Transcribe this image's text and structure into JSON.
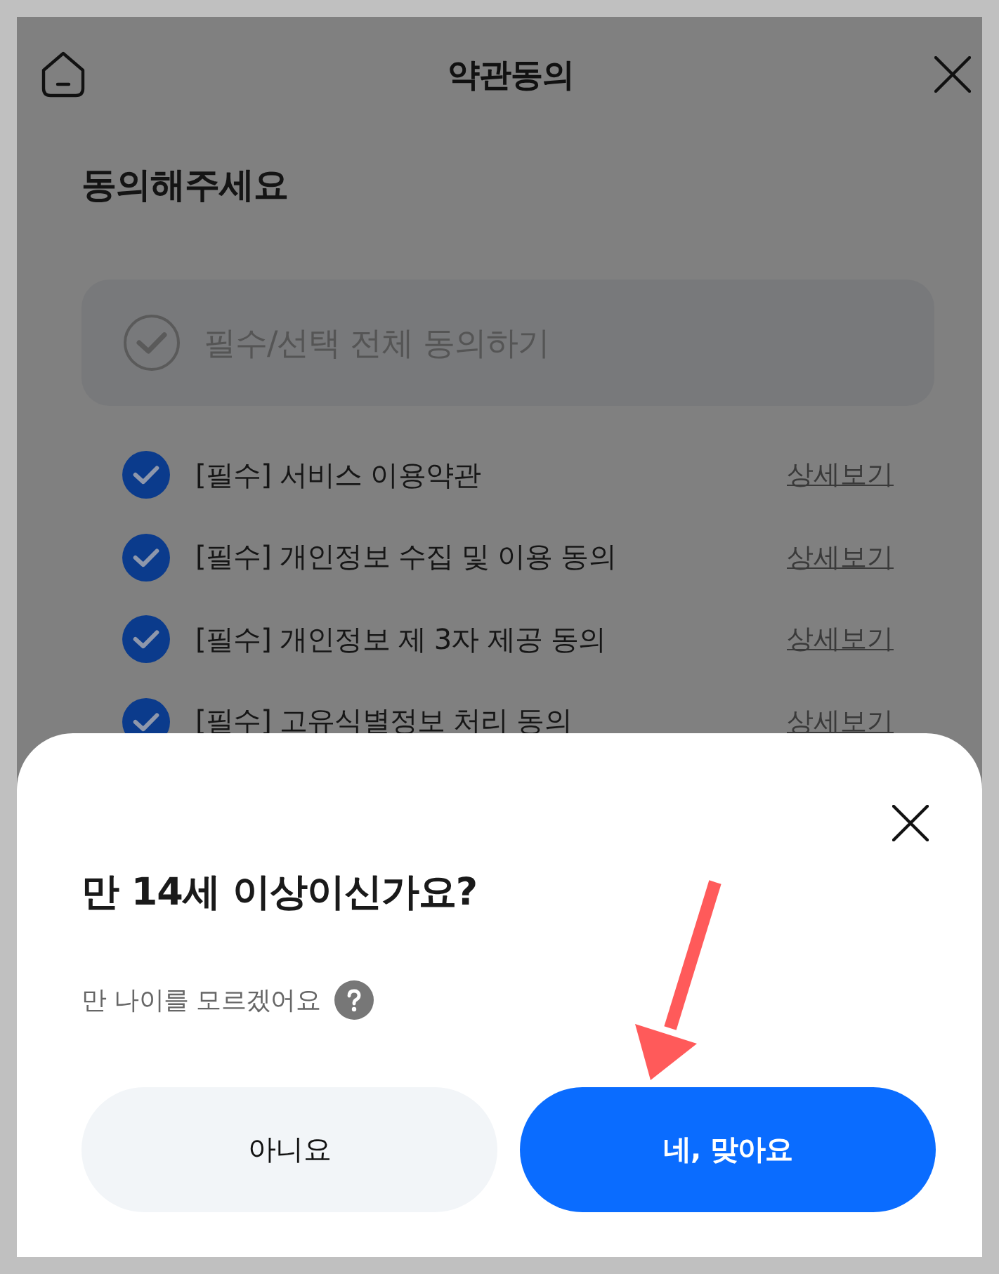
{
  "header": {
    "title": "약관동의"
  },
  "heading": "동의해주세요",
  "agree_all": {
    "label": "필수/선택 전체 동의하기",
    "checked": false
  },
  "terms": [
    {
      "label": "[필수] 서비스 이용약관",
      "checked": true,
      "link": "상세보기"
    },
    {
      "label": "[필수] 개인정보 수집 및 이용 동의",
      "checked": true,
      "link": "상세보기"
    },
    {
      "label": "[필수] 개인정보 제 3자 제공 동의",
      "checked": true,
      "link": "상세보기"
    },
    {
      "label": "[필수] 고유식별정보 처리 동의",
      "checked": true,
      "link": "상세보기"
    }
  ],
  "sheet": {
    "title": "만 14세 이상이신가요?",
    "help_text": "만 나이를 모르겠어요",
    "buttons": [
      {
        "label": "아니요",
        "kind": "secondary"
      },
      {
        "label": "네, 맞아요",
        "kind": "primary"
      }
    ]
  }
}
